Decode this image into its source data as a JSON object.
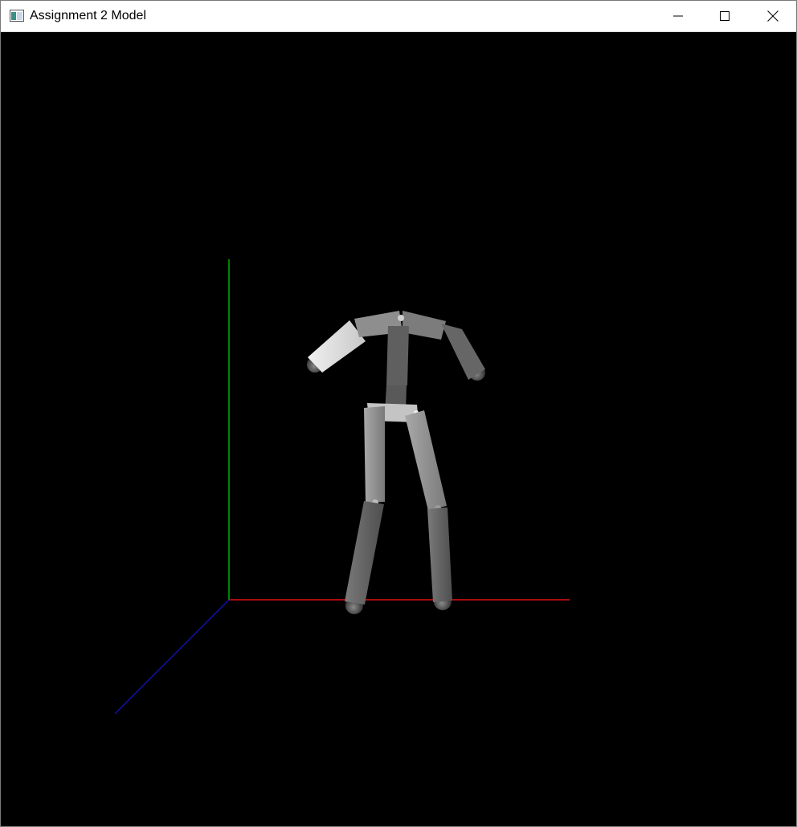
{
  "window": {
    "title": "Assignment 2 Model",
    "app_icon": "opengl-window-icon",
    "controls": {
      "minimize_icon": "minimize-icon",
      "maximize_icon": "maximize-icon",
      "close_icon": "close-icon"
    }
  },
  "scene": {
    "background": "#000000",
    "axis_colors": {
      "x": "#e01010",
      "y": "#00b000",
      "z": "#1010b0"
    },
    "model_colors": {
      "light": "#dcdcdc",
      "mid": "#8c8c8c",
      "dark": "#5e5e5e"
    }
  }
}
